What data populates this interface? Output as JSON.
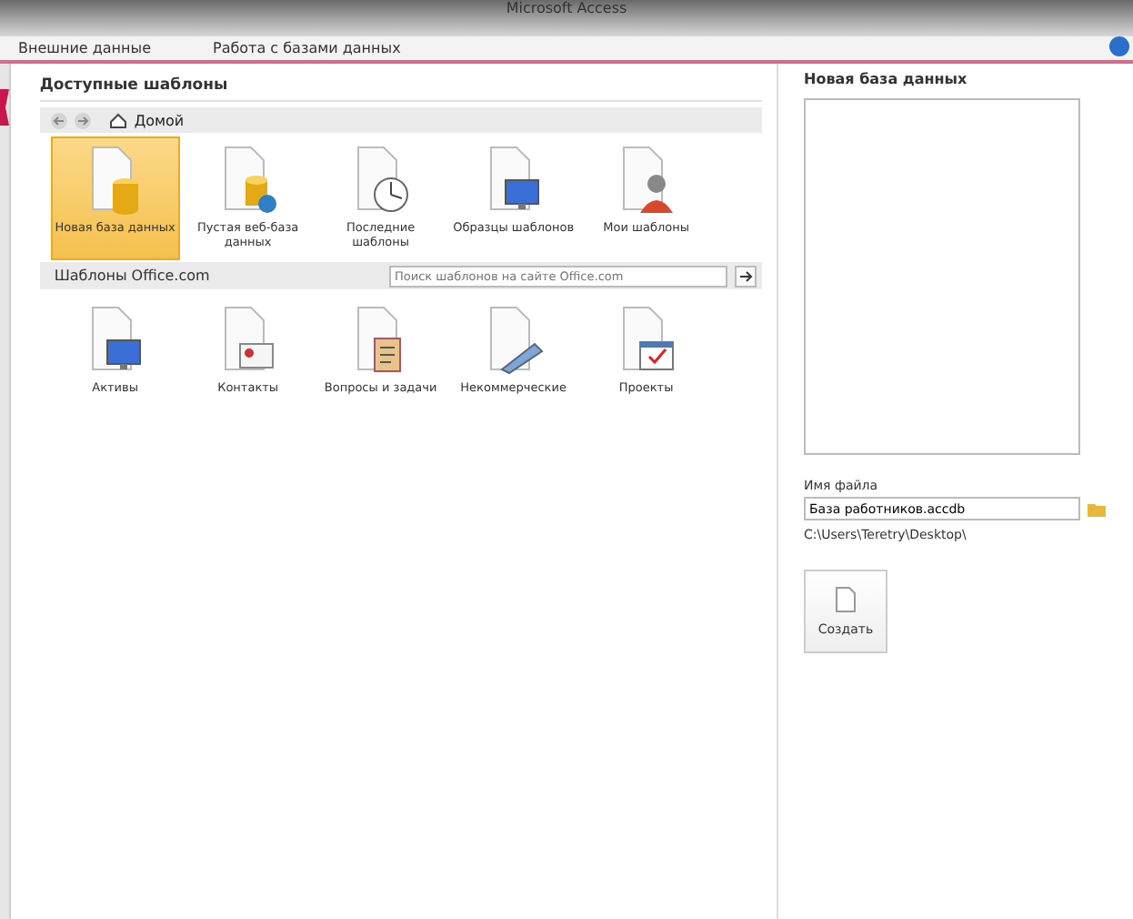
{
  "window": {
    "title": "Microsoft Access"
  },
  "ribbon_tabs": [
    {
      "label": "Внешние данные"
    },
    {
      "label": "Работа с базами данных"
    }
  ],
  "available": {
    "title": "Доступные шаблоны",
    "breadcrumb": "Домой",
    "items": [
      {
        "label": "Новая база данных",
        "kind": "database",
        "selected": true
      },
      {
        "label": "Пустая веб-база данных",
        "kind": "webdb",
        "selected": false
      },
      {
        "label": "Последние шаблоны",
        "kind": "clock",
        "selected": false
      },
      {
        "label": "Образцы шаблонов",
        "kind": "monitor",
        "selected": false
      },
      {
        "label": "Мои шаблоны",
        "kind": "person",
        "selected": false
      }
    ]
  },
  "office": {
    "title": "Шаблоны Office.com",
    "search": {
      "placeholder": "Поиск шаблонов на сайте Office.com"
    },
    "items": [
      {
        "label": "Активы",
        "kind": "monitor",
        "selected": false
      },
      {
        "label": "Контакты",
        "kind": "card",
        "selected": false
      },
      {
        "label": "Вопросы и задачи",
        "kind": "clipboard",
        "selected": false
      },
      {
        "label": "Некоммерческие",
        "kind": "pen",
        "selected": false
      },
      {
        "label": "Проекты",
        "kind": "calendar",
        "selected": false
      }
    ]
  },
  "new_db": {
    "title": "Новая база данных",
    "file_label": "Имя файла",
    "file_name": "База работников.accdb",
    "path": "C:\\Users\\Teretry\\Desktop\\",
    "create_button": "Создать"
  }
}
